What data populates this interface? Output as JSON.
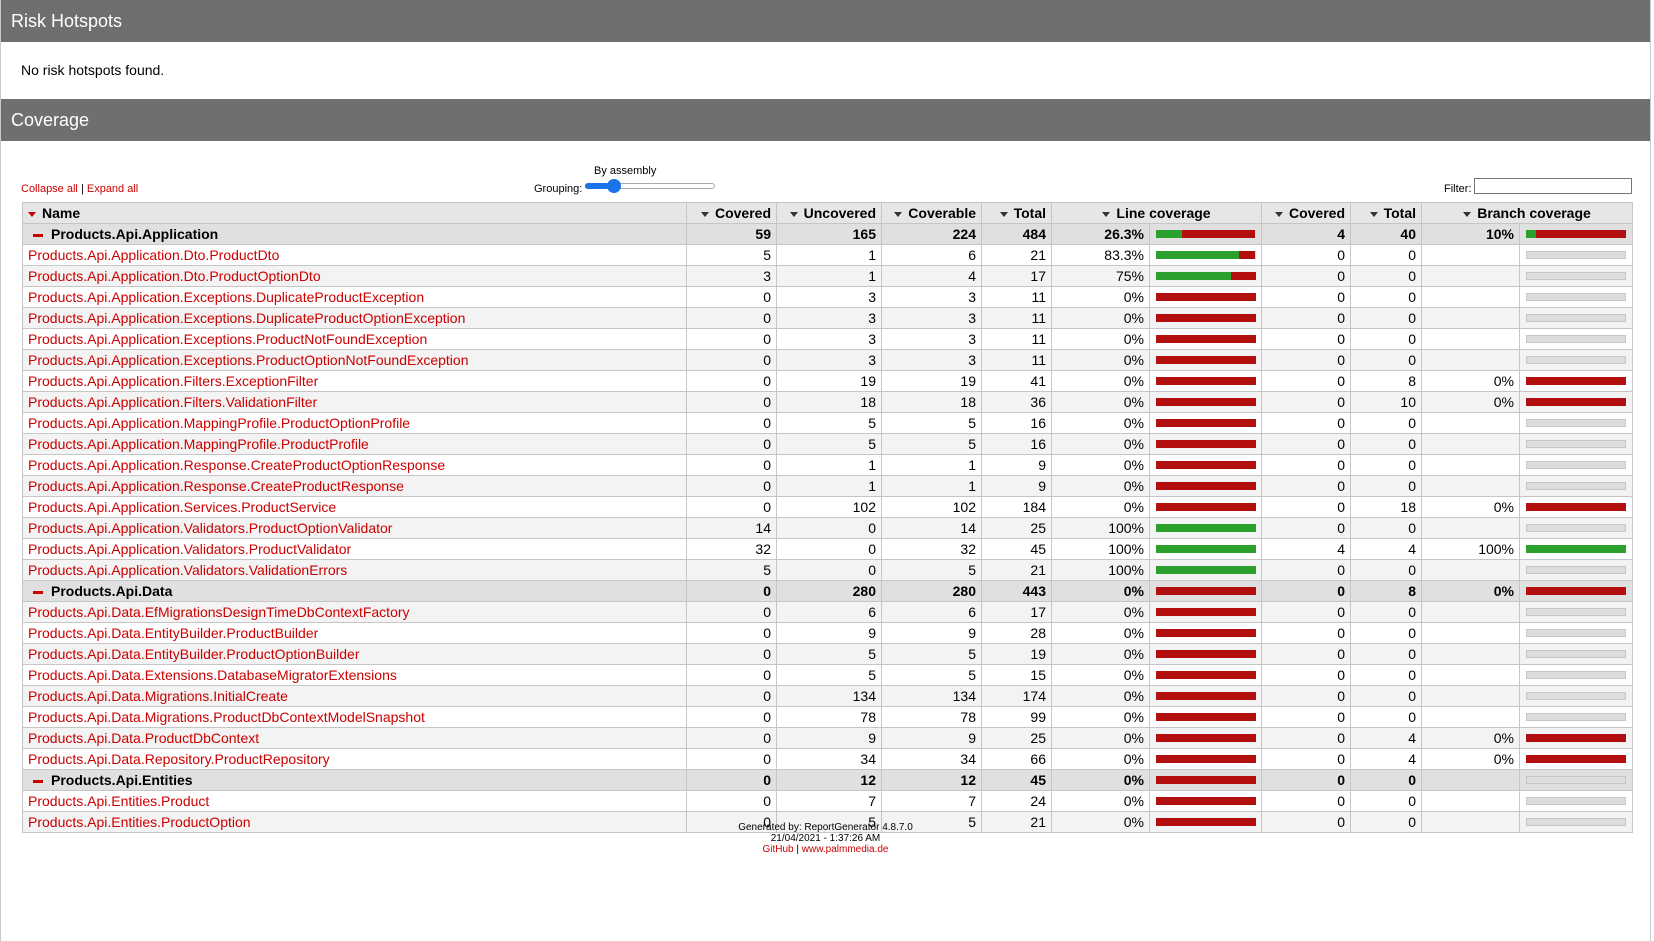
{
  "risk": {
    "title": "Risk Hotspots",
    "message": "No risk hotspots found."
  },
  "coverage": {
    "title": "Coverage",
    "collapse_all": "Collapse all",
    "separator": "|",
    "expand_all": "Expand all",
    "grouping_label": "Grouping:",
    "grouping_value": "By assembly",
    "grouping_level": 0.2,
    "filter_label": "Filter:",
    "filter_value": "",
    "headers": [
      "Name",
      "Covered",
      "Uncovered",
      "Coverable",
      "Total",
      "Line coverage",
      "Covered",
      "Total",
      "Branch coverage"
    ]
  },
  "rows": [
    {
      "type": "assembly",
      "name": "Products.Api.Application",
      "covered": "59",
      "uncovered": "165",
      "coverable": "224",
      "total": "484",
      "line_pct": "26.3%",
      "line_value": 26.3,
      "bcovered": "4",
      "btotal": "40",
      "branch_pct": "10%",
      "branch_value": 10
    },
    {
      "type": "class",
      "name": "Products.Api.Application.Dto.ProductDto",
      "covered": "5",
      "uncovered": "1",
      "coverable": "6",
      "total": "21",
      "line_pct": "83.3%",
      "line_value": 83.3,
      "bcovered": "0",
      "btotal": "0",
      "branch_pct": "",
      "branch_value": null
    },
    {
      "type": "class",
      "name": "Products.Api.Application.Dto.ProductOptionDto",
      "covered": "3",
      "uncovered": "1",
      "coverable": "4",
      "total": "17",
      "line_pct": "75%",
      "line_value": 75,
      "bcovered": "0",
      "btotal": "0",
      "branch_pct": "",
      "branch_value": null
    },
    {
      "type": "class",
      "name": "Products.Api.Application.Exceptions.DuplicateProductException",
      "covered": "0",
      "uncovered": "3",
      "coverable": "3",
      "total": "11",
      "line_pct": "0%",
      "line_value": 0,
      "bcovered": "0",
      "btotal": "0",
      "branch_pct": "",
      "branch_value": null
    },
    {
      "type": "class",
      "name": "Products.Api.Application.Exceptions.DuplicateProductOptionException",
      "covered": "0",
      "uncovered": "3",
      "coverable": "3",
      "total": "11",
      "line_pct": "0%",
      "line_value": 0,
      "bcovered": "0",
      "btotal": "0",
      "branch_pct": "",
      "branch_value": null
    },
    {
      "type": "class",
      "name": "Products.Api.Application.Exceptions.ProductNotFoundException",
      "covered": "0",
      "uncovered": "3",
      "coverable": "3",
      "total": "11",
      "line_pct": "0%",
      "line_value": 0,
      "bcovered": "0",
      "btotal": "0",
      "branch_pct": "",
      "branch_value": null
    },
    {
      "type": "class",
      "name": "Products.Api.Application.Exceptions.ProductOptionNotFoundException",
      "covered": "0",
      "uncovered": "3",
      "coverable": "3",
      "total": "11",
      "line_pct": "0%",
      "line_value": 0,
      "bcovered": "0",
      "btotal": "0",
      "branch_pct": "",
      "branch_value": null
    },
    {
      "type": "class",
      "name": "Products.Api.Application.Filters.ExceptionFilter",
      "covered": "0",
      "uncovered": "19",
      "coverable": "19",
      "total": "41",
      "line_pct": "0%",
      "line_value": 0,
      "bcovered": "0",
      "btotal": "8",
      "branch_pct": "0%",
      "branch_value": 0
    },
    {
      "type": "class",
      "name": "Products.Api.Application.Filters.ValidationFilter",
      "covered": "0",
      "uncovered": "18",
      "coverable": "18",
      "total": "36",
      "line_pct": "0%",
      "line_value": 0,
      "bcovered": "0",
      "btotal": "10",
      "branch_pct": "0%",
      "branch_value": 0
    },
    {
      "type": "class",
      "name": "Products.Api.Application.MappingProfile.ProductOptionProfile",
      "covered": "0",
      "uncovered": "5",
      "coverable": "5",
      "total": "16",
      "line_pct": "0%",
      "line_value": 0,
      "bcovered": "0",
      "btotal": "0",
      "branch_pct": "",
      "branch_value": null
    },
    {
      "type": "class",
      "name": "Products.Api.Application.MappingProfile.ProductProfile",
      "covered": "0",
      "uncovered": "5",
      "coverable": "5",
      "total": "16",
      "line_pct": "0%",
      "line_value": 0,
      "bcovered": "0",
      "btotal": "0",
      "branch_pct": "",
      "branch_value": null
    },
    {
      "type": "class",
      "name": "Products.Api.Application.Response.CreateProductOptionResponse",
      "covered": "0",
      "uncovered": "1",
      "coverable": "1",
      "total": "9",
      "line_pct": "0%",
      "line_value": 0,
      "bcovered": "0",
      "btotal": "0",
      "branch_pct": "",
      "branch_value": null
    },
    {
      "type": "class",
      "name": "Products.Api.Application.Response.CreateProductResponse",
      "covered": "0",
      "uncovered": "1",
      "coverable": "1",
      "total": "9",
      "line_pct": "0%",
      "line_value": 0,
      "bcovered": "0",
      "btotal": "0",
      "branch_pct": "",
      "branch_value": null
    },
    {
      "type": "class",
      "name": "Products.Api.Application.Services.ProductService",
      "covered": "0",
      "uncovered": "102",
      "coverable": "102",
      "total": "184",
      "line_pct": "0%",
      "line_value": 0,
      "bcovered": "0",
      "btotal": "18",
      "branch_pct": "0%",
      "branch_value": 0
    },
    {
      "type": "class",
      "name": "Products.Api.Application.Validators.ProductOptionValidator",
      "covered": "14",
      "uncovered": "0",
      "coverable": "14",
      "total": "25",
      "line_pct": "100%",
      "line_value": 100,
      "bcovered": "0",
      "btotal": "0",
      "branch_pct": "",
      "branch_value": null
    },
    {
      "type": "class",
      "name": "Products.Api.Application.Validators.ProductValidator",
      "covered": "32",
      "uncovered": "0",
      "coverable": "32",
      "total": "45",
      "line_pct": "100%",
      "line_value": 100,
      "bcovered": "4",
      "btotal": "4",
      "branch_pct": "100%",
      "branch_value": 100
    },
    {
      "type": "class",
      "name": "Products.Api.Application.Validators.ValidationErrors",
      "covered": "5",
      "uncovered": "0",
      "coverable": "5",
      "total": "21",
      "line_pct": "100%",
      "line_value": 100,
      "bcovered": "0",
      "btotal": "0",
      "branch_pct": "",
      "branch_value": null
    },
    {
      "type": "assembly",
      "name": "Products.Api.Data",
      "covered": "0",
      "uncovered": "280",
      "coverable": "280",
      "total": "443",
      "line_pct": "0%",
      "line_value": 0,
      "bcovered": "0",
      "btotal": "8",
      "branch_pct": "0%",
      "branch_value": 0
    },
    {
      "type": "class",
      "name": "Products.Api.Data.EfMigrationsDesignTimeDbContextFactory",
      "covered": "0",
      "uncovered": "6",
      "coverable": "6",
      "total": "17",
      "line_pct": "0%",
      "line_value": 0,
      "bcovered": "0",
      "btotal": "0",
      "branch_pct": "",
      "branch_value": null
    },
    {
      "type": "class",
      "name": "Products.Api.Data.EntityBuilder.ProductBuilder",
      "covered": "0",
      "uncovered": "9",
      "coverable": "9",
      "total": "28",
      "line_pct": "0%",
      "line_value": 0,
      "bcovered": "0",
      "btotal": "0",
      "branch_pct": "",
      "branch_value": null
    },
    {
      "type": "class",
      "name": "Products.Api.Data.EntityBuilder.ProductOptionBuilder",
      "covered": "0",
      "uncovered": "5",
      "coverable": "5",
      "total": "19",
      "line_pct": "0%",
      "line_value": 0,
      "bcovered": "0",
      "btotal": "0",
      "branch_pct": "",
      "branch_value": null
    },
    {
      "type": "class",
      "name": "Products.Api.Data.Extensions.DatabaseMigratorExtensions",
      "covered": "0",
      "uncovered": "5",
      "coverable": "5",
      "total": "15",
      "line_pct": "0%",
      "line_value": 0,
      "bcovered": "0",
      "btotal": "0",
      "branch_pct": "",
      "branch_value": null
    },
    {
      "type": "class",
      "name": "Products.Api.Data.Migrations.InitialCreate",
      "covered": "0",
      "uncovered": "134",
      "coverable": "134",
      "total": "174",
      "line_pct": "0%",
      "line_value": 0,
      "bcovered": "0",
      "btotal": "0",
      "branch_pct": "",
      "branch_value": null
    },
    {
      "type": "class",
      "name": "Products.Api.Data.Migrations.ProductDbContextModelSnapshot",
      "covered": "0",
      "uncovered": "78",
      "coverable": "78",
      "total": "99",
      "line_pct": "0%",
      "line_value": 0,
      "bcovered": "0",
      "btotal": "0",
      "branch_pct": "",
      "branch_value": null
    },
    {
      "type": "class",
      "name": "Products.Api.Data.ProductDbContext",
      "covered": "0",
      "uncovered": "9",
      "coverable": "9",
      "total": "25",
      "line_pct": "0%",
      "line_value": 0,
      "bcovered": "0",
      "btotal": "4",
      "branch_pct": "0%",
      "branch_value": 0
    },
    {
      "type": "class",
      "name": "Products.Api.Data.Repository.ProductRepository",
      "covered": "0",
      "uncovered": "34",
      "coverable": "34",
      "total": "66",
      "line_pct": "0%",
      "line_value": 0,
      "bcovered": "0",
      "btotal": "4",
      "branch_pct": "0%",
      "branch_value": 0
    },
    {
      "type": "assembly",
      "name": "Products.Api.Entities",
      "covered": "0",
      "uncovered": "12",
      "coverable": "12",
      "total": "45",
      "line_pct": "0%",
      "line_value": 0,
      "bcovered": "0",
      "btotal": "0",
      "branch_pct": "",
      "branch_value": null
    },
    {
      "type": "class",
      "name": "Products.Api.Entities.Product",
      "covered": "0",
      "uncovered": "7",
      "coverable": "7",
      "total": "24",
      "line_pct": "0%",
      "line_value": 0,
      "bcovered": "0",
      "btotal": "0",
      "branch_pct": "",
      "branch_value": null
    },
    {
      "type": "class",
      "name": "Products.Api.Entities.ProductOption",
      "covered": "0",
      "uncovered": "5",
      "coverable": "5",
      "total": "21",
      "line_pct": "0%",
      "line_value": 0,
      "bcovered": "0",
      "btotal": "0",
      "branch_pct": "",
      "branch_value": null
    }
  ],
  "footer": {
    "generated": "Generated by: ReportGenerator 4.8.7.0",
    "date": "21/04/2021 - 1:37:26 AM",
    "github": "GitHub",
    "separator": "|",
    "site": "www.palmmedia.de"
  },
  "colors": {
    "covered": "#2ca02c",
    "uncovered": "#b30f0f",
    "no_data": "#dddddd",
    "link": "#cc0000",
    "header_bar": "#6f6f6f"
  }
}
